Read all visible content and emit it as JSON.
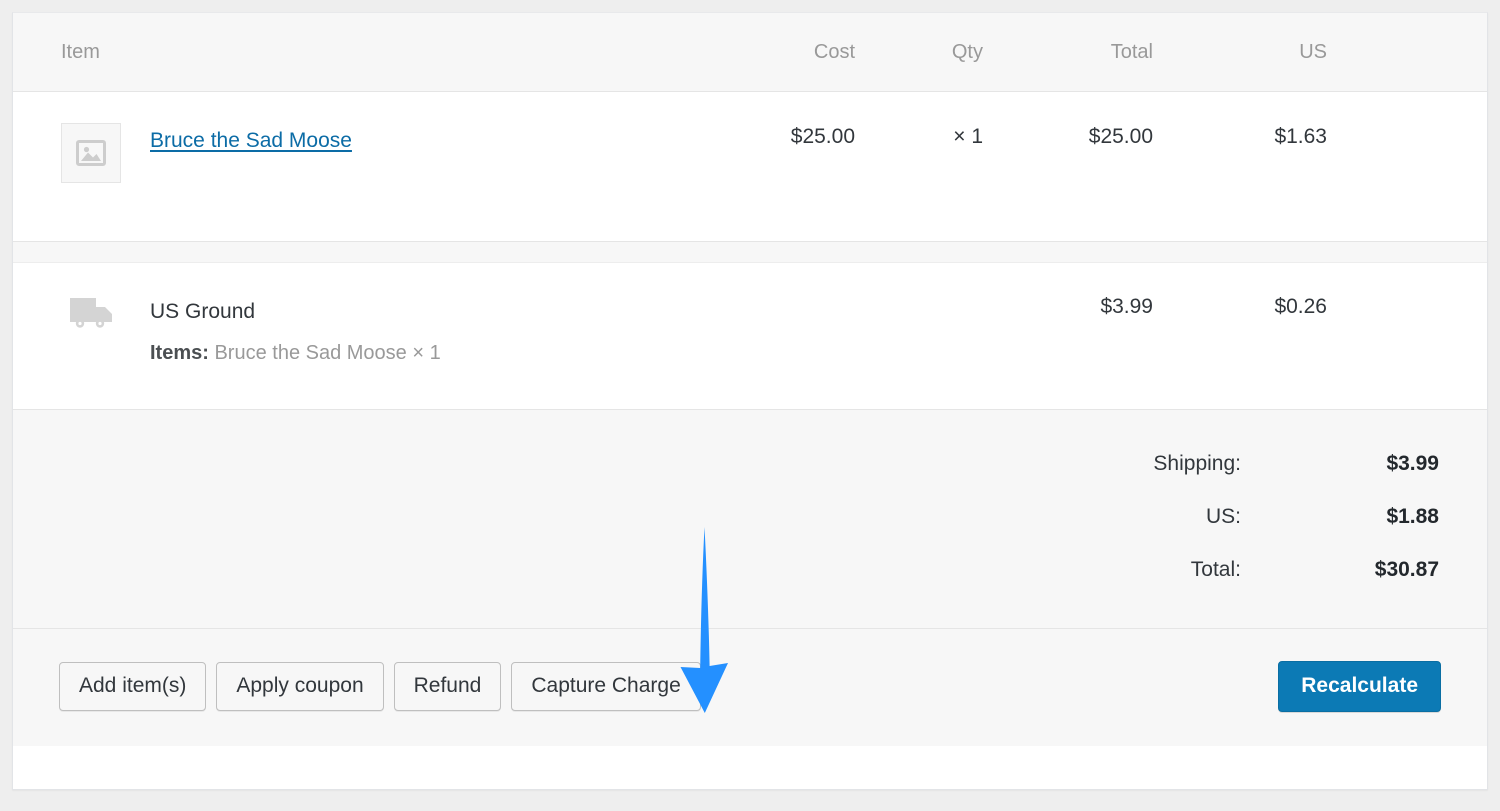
{
  "table": {
    "headers": {
      "item": "Item",
      "cost": "Cost",
      "qty": "Qty",
      "total": "Total",
      "tax": "US"
    },
    "line_items": [
      {
        "thumb_icon": "image-placeholder-icon",
        "name": "Bruce the Sad Moose",
        "cost": "$25.00",
        "qty": "× 1",
        "total": "$25.00",
        "tax": "$1.63"
      }
    ],
    "shipping_items": [
      {
        "icon": "truck-icon",
        "name": "US Ground",
        "meta_label": "Items:",
        "meta_value": "Bruce the Sad Moose × 1",
        "cost": "",
        "qty": "",
        "total": "$3.99",
        "tax": "$0.26"
      }
    ]
  },
  "totals": [
    {
      "label": "Shipping:",
      "value": "$3.99"
    },
    {
      "label": "US:",
      "value": "$1.88"
    },
    {
      "label": "Total:",
      "value": "$30.87"
    }
  ],
  "footer": {
    "buttons": [
      {
        "label": "Add item(s)",
        "name": "add-items-button"
      },
      {
        "label": "Apply coupon",
        "name": "apply-coupon-button"
      },
      {
        "label": "Refund",
        "name": "refund-button"
      },
      {
        "label": "Capture Charge",
        "name": "capture-charge-button"
      }
    ],
    "primary_button": "Recalculate"
  },
  "annotation": {
    "type": "down-arrow",
    "color": "#2490ff",
    "points_to": "Capture Charge"
  },
  "colors": {
    "link": "#0c6ca6",
    "primary_button": "#0c7ab5",
    "header_text": "#999999",
    "body_text": "#32373c",
    "panel_bg": "#ffffff",
    "muted_bg": "#f7f7f7",
    "border": "#e5e5e5",
    "arrow": "#2490ff"
  }
}
